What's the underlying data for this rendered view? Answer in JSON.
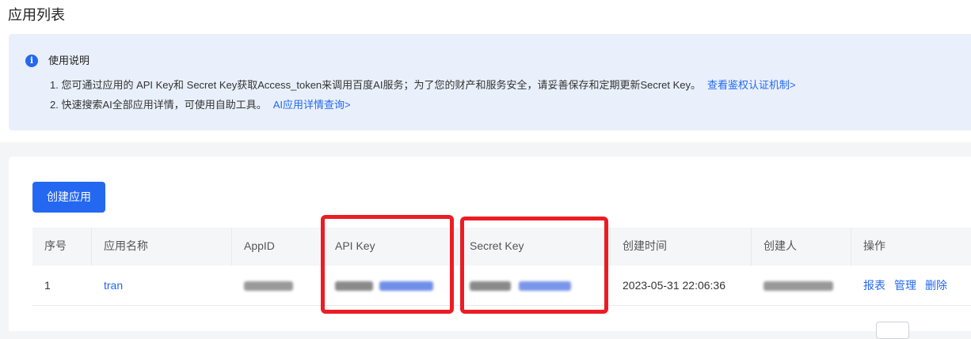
{
  "page_title": "应用列表",
  "notice": {
    "title": "使用说明",
    "line1": "1. 您可通过应用的 API Key和 Secret Key获取Access_token来调用百度AI服务；为了您的财产和服务安全，请妥善保存和定期更新Secret Key。",
    "line1_link": "查看鉴权认证机制>",
    "line2": "2. 快速搜索AI全部应用详情，可使用自助工具。",
    "line2_link": "AI应用详情查询>"
  },
  "create_button": "创建应用",
  "table": {
    "headers": [
      "序号",
      "应用名称",
      "AppID",
      "API Key",
      "Secret Key",
      "创建时间",
      "创建人",
      "操作"
    ],
    "rows": [
      {
        "index": "1",
        "name": "tran",
        "created": "2023-05-31 22:06:36",
        "actions": [
          "报表",
          "管理",
          "删除"
        ]
      }
    ]
  },
  "colors": {
    "accent": "#2468f2",
    "highlight": "#ec1c24",
    "notice_bg": "#e9f0fb"
  }
}
